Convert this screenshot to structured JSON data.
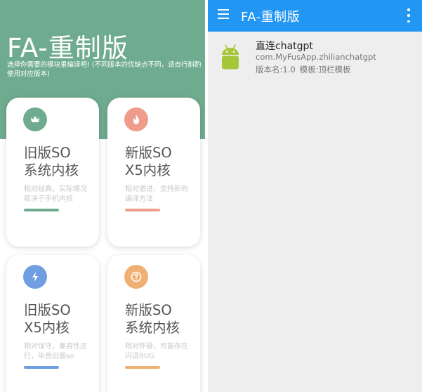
{
  "left": {
    "title": "FA-重制版",
    "subtitle": "选择你需要的模块重编译吧! (不同版本的优缺点不同，请自行斟酌使用对应版本)",
    "cards": [
      {
        "icon": "crown-icon",
        "icon_color": "#6fab8e",
        "title_line1": "旧版SO",
        "title_line2": "系统内核",
        "desc_line1": "相对经典，实际情况",
        "desc_line2": "取决于手机内核",
        "accent": "#6fab8e"
      },
      {
        "icon": "flame-icon",
        "icon_color": "#ef9c8c",
        "title_line1": "新版SO",
        "title_line2": "X5内核",
        "desc_line1": "相对激进，支持新的",
        "desc_line2": "编译方法",
        "accent": "#ef9c8c"
      },
      {
        "icon": "lightning-icon",
        "icon_color": "#6f9fe0",
        "title_line1": "旧版SO",
        "title_line2": "X5内核",
        "desc_line1": "相对保守，兼容性还",
        "desc_line2": "行，毕竟旧版so",
        "accent": "#6f9fe0"
      },
      {
        "icon": "question-icon",
        "icon_color": "#f0b074",
        "title_line1": "新版SO",
        "title_line2": "系统内核",
        "desc_line1": "相对怀疑，可能存在",
        "desc_line2": "闪退BUG",
        "accent": "#f0b074"
      }
    ]
  },
  "right": {
    "appbar": {
      "title": "FA-重制版",
      "menu_icon": "hamburger-menu-icon",
      "overflow_icon": "more-vert-icon",
      "color": "#2196f3"
    },
    "item": {
      "icon": "android-icon",
      "icon_color": "#a4c639",
      "name": "直连chatgpt",
      "package": "com.MyFusApp.zhilianchatgpt",
      "version": "版本名:1.0",
      "template": "模板:顶栏模板"
    }
  }
}
